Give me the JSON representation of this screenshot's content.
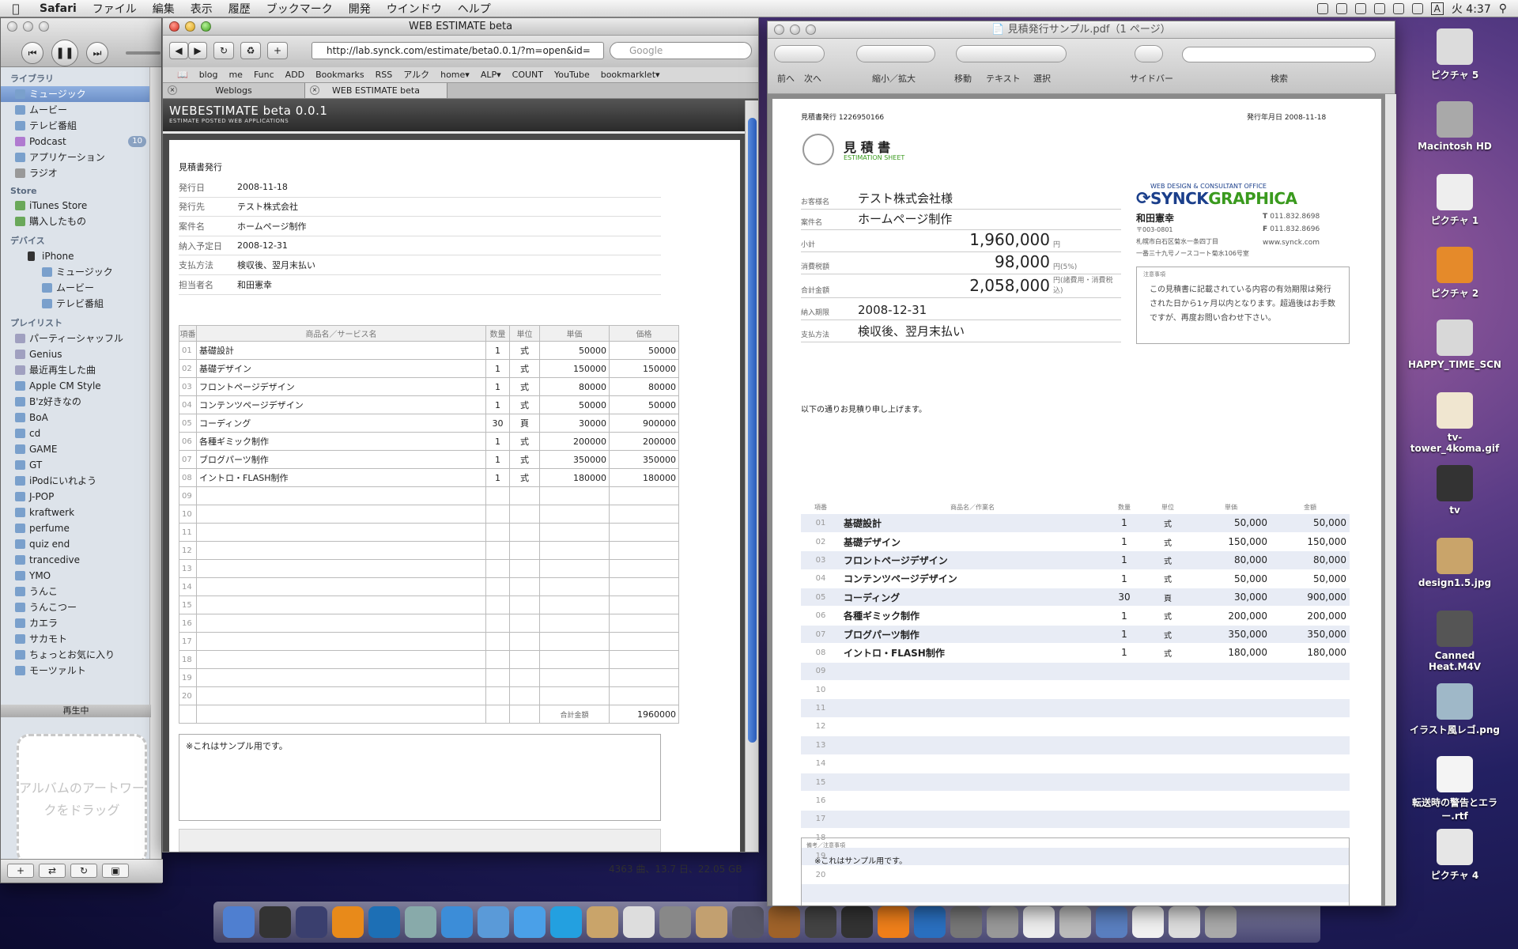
{
  "menubar": {
    "app": "Safari",
    "items": [
      "ファイル",
      "編集",
      "表示",
      "履歴",
      "ブックマーク",
      "開発",
      "ウインドウ",
      "ヘルプ"
    ],
    "clock": "火 4:37",
    "input": "A"
  },
  "itunes": {
    "sections": {
      "library": "ライブラリ",
      "store": "Store",
      "devices": "デバイス",
      "playlists": "プレイリスト"
    },
    "library": [
      {
        "label": "ミュージック"
      },
      {
        "label": "ムービー"
      },
      {
        "label": "テレビ番組"
      },
      {
        "label": "Podcast",
        "badge": "10"
      },
      {
        "label": "アプリケーション"
      },
      {
        "label": "ラジオ"
      }
    ],
    "store": [
      "iTunes Store",
      "購入したもの"
    ],
    "device": "iPhone",
    "device_items": [
      "ミュージック",
      "ムービー",
      "テレビ番組"
    ],
    "playlists": [
      "パーティーシャッフル",
      "Genius",
      "最近再生した曲",
      "Apple CM Style",
      "B'z好きなの",
      "BoA",
      "cd",
      "GAME",
      "GT",
      "iPodにいれよう",
      "J-POP",
      "kraftwerk",
      "perfume",
      "quiz end",
      "trancedive",
      "YMO",
      "うんこ",
      "うんこつー",
      "カエラ",
      "サカモト",
      "ちょっとお気に入り",
      "モーツァルト"
    ],
    "now_playing": "再生中",
    "artwork_hint": "アルバムのアートワークをドラッグ",
    "status": "4363 曲、13.7 日、22.05 GB"
  },
  "safari": {
    "title": "WEB ESTIMATE beta",
    "url": "http://lab.synck.com/estimate/beta0.0.1/?m=open&id=",
    "search_placeholder": "Google",
    "bookmarks": [
      "blog",
      "me",
      "Func",
      "ADD",
      "Bookmarks",
      "RSS",
      "アルク",
      "home▾",
      "ALP▾",
      "COUNT",
      "YouTube",
      "bookmarklet▾"
    ],
    "tabs": [
      "Weblogs",
      "WEB ESTIMATE beta"
    ],
    "site_title": "WEBESTIMATE beta 0.0.1",
    "site_sub": "ESTIMATE POSTED WEB APPLICATIONS",
    "form_title": "見積書発行",
    "fields": [
      {
        "label": "発行日",
        "value": "2008-11-18"
      },
      {
        "label": "発行先",
        "value": "テスト株式会社"
      },
      {
        "label": "案件名",
        "value": "ホームページ制作"
      },
      {
        "label": "納入予定日",
        "value": "2008-12-31"
      },
      {
        "label": "支払方法",
        "value": "検収後、翌月末払い"
      },
      {
        "label": "担当者名",
        "value": "和田憲幸"
      }
    ],
    "headers": [
      "項番",
      "商品名／サービス名",
      "数量",
      "単位",
      "単価",
      "価格"
    ],
    "rows": [
      {
        "no": "01",
        "name": "基礎設計",
        "qty": "1",
        "unit": "式",
        "price": "50000",
        "total": "50000"
      },
      {
        "no": "02",
        "name": "基礎デザイン",
        "qty": "1",
        "unit": "式",
        "price": "150000",
        "total": "150000"
      },
      {
        "no": "03",
        "name": "フロントページデザイン",
        "qty": "1",
        "unit": "式",
        "price": "80000",
        "total": "80000"
      },
      {
        "no": "04",
        "name": "コンテンツページデザイン",
        "qty": "1",
        "unit": "式",
        "price": "50000",
        "total": "50000"
      },
      {
        "no": "05",
        "name": "コーディング",
        "qty": "30",
        "unit": "頁",
        "price": "30000",
        "total": "900000"
      },
      {
        "no": "06",
        "name": "各種ギミック制作",
        "qty": "1",
        "unit": "式",
        "price": "200000",
        "total": "200000"
      },
      {
        "no": "07",
        "name": "ブログパーツ制作",
        "qty": "1",
        "unit": "式",
        "price": "350000",
        "total": "350000"
      },
      {
        "no": "08",
        "name": "イントロ・FLASH制作",
        "qty": "1",
        "unit": "式",
        "price": "180000",
        "total": "180000"
      }
    ],
    "empty_rows": [
      "09",
      "10",
      "11",
      "12",
      "13",
      "14",
      "15",
      "16",
      "17",
      "18",
      "19",
      "20"
    ],
    "total_label": "合計金額",
    "total_value": "1960000",
    "note": "※これはサンプル用です。"
  },
  "preview": {
    "title": "見積発行サンプル.pdf（1 ページ）",
    "toolbar": [
      "前へ",
      "次へ",
      "縮小／拡大",
      "移動",
      "テキスト",
      "選択",
      "サイドバー",
      "検索"
    ],
    "doc_no_label": "見積書発行",
    "doc_no": "1226950166",
    "issue_label": "発行年月日",
    "issue_date": "2008-11-18",
    "heading": "見 積 書",
    "heading_en": "ESTIMATION SHEET",
    "client_label": "お客様名",
    "client": "テスト株式会社様",
    "project_label": "案件名",
    "project": "ホームページ制作",
    "subtotal_label": "小計",
    "subtotal": "1,960,000",
    "subtotal_unit": "円",
    "tax_label": "消費税額",
    "tax": "98,000",
    "tax_unit": "円(5%)",
    "grand_label": "合計金額",
    "grand": "2,058,000",
    "grand_unit": "円(諸費用・消費税込)",
    "due_label": "納入期限",
    "due": "2008-12-31",
    "pay_label": "支払方法",
    "pay": "検収後、翌月末払い",
    "company_tag": "WEB DESIGN & CONSULTANT OFFICE",
    "company_a": "SYNCK",
    "company_b": "GRAPHICA",
    "person": "和田憲幸",
    "postal": "〒003-0801",
    "address1": "札幌市白石区菊水一条四丁目",
    "address2": "一番三十九号ノースコート菊水106号室",
    "tel": "011.832.8698",
    "fax": "011.832.8696",
    "web": "www.synck.com",
    "notice_label": "注意事項",
    "notice": "この見積書に記載されている内容の有効期限は発行された日から1ヶ月以内となります。超過後はお手数ですが、再度お問い合わせ下さい。",
    "intro": "以下の通りお見積り申し上げます。",
    "headers": [
      "項番",
      "商品名／作業名",
      "数量",
      "単位",
      "単価",
      "金額"
    ],
    "rows": [
      {
        "no": "01",
        "name": "基礎設計",
        "qty": "1",
        "unit": "式",
        "price": "50,000",
        "total": "50,000"
      },
      {
        "no": "02",
        "name": "基礎デザイン",
        "qty": "1",
        "unit": "式",
        "price": "150,000",
        "total": "150,000"
      },
      {
        "no": "03",
        "name": "フロントページデザイン",
        "qty": "1",
        "unit": "式",
        "price": "80,000",
        "total": "80,000"
      },
      {
        "no": "04",
        "name": "コンテンツページデザイン",
        "qty": "1",
        "unit": "式",
        "price": "50,000",
        "total": "50,000"
      },
      {
        "no": "05",
        "name": "コーディング",
        "qty": "30",
        "unit": "頁",
        "price": "30,000",
        "total": "900,000"
      },
      {
        "no": "06",
        "name": "各種ギミック制作",
        "qty": "1",
        "unit": "式",
        "price": "200,000",
        "total": "200,000"
      },
      {
        "no": "07",
        "name": "ブログパーツ制作",
        "qty": "1",
        "unit": "式",
        "price": "350,000",
        "total": "350,000"
      },
      {
        "no": "08",
        "name": "イントロ・FLASH制作",
        "qty": "1",
        "unit": "式",
        "price": "180,000",
        "total": "180,000"
      }
    ],
    "empty_rows": [
      "09",
      "10",
      "11",
      "12",
      "13",
      "14",
      "15",
      "16",
      "17",
      "18",
      "19",
      "20"
    ],
    "memo_label": "備考／注意事項",
    "memo": "※これはサンプル用です。"
  },
  "desktop": [
    "ピクチャ 5",
    "Macintosh HD",
    "ピクチャ 1",
    "ピクチャ 2",
    "HAPPY_TIME_SCN",
    "tv-tower_4koma.gif",
    "tv",
    "design1.5.jpg",
    "Canned Heat.M4V",
    "イラスト風レゴ.png",
    "転送時の警告とエラー.rtf",
    "ピクチャ 4"
  ],
  "dock": [
    "Finder",
    "Dashboard",
    "AE",
    "Ai",
    "Ps",
    "Preview",
    "Safari",
    "iChat",
    "iTunes",
    "Skype",
    "Mail",
    "iCal",
    "Photo",
    "iPhoto",
    "Keynote",
    "GarageBand",
    "iMovie",
    "DVD",
    "VLC",
    "QuickTime",
    "Activity",
    "System Prefs",
    "Textedit",
    "Script",
    "Xcode",
    "Pages",
    "Documents",
    "Trash"
  ],
  "colors": {
    "accent": "#2d63c8",
    "brand_green": "#3a9a1e",
    "brand_blue": "#1b3f8b"
  }
}
